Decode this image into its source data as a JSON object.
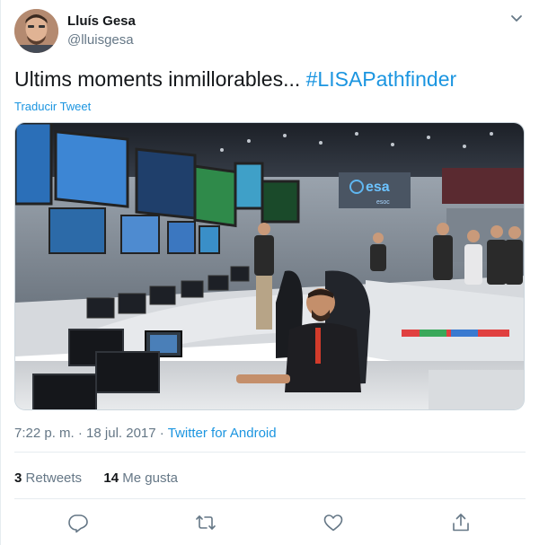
{
  "author": {
    "name": "Lluís Gesa",
    "handle": "@lluisgesa"
  },
  "tweet": {
    "text_before": "Ultims moments inmillorables... ",
    "hashtag": "#LISAPathfinder",
    "translate_label": "Traducir Tweet"
  },
  "media": {
    "screen_logo": "esa",
    "screen_subtitle": "esoc",
    "colors": {
      "room": "#8a94a0",
      "ceiling": "#2a2f38",
      "screen": "#3b78c8",
      "logo_bg": "#1e3a6e"
    }
  },
  "meta": {
    "time": "7:22 p. m.",
    "date": "18 jul. 2017",
    "separator": "·",
    "source": "Twitter for Android"
  },
  "stats": {
    "retweets_count": "3",
    "retweets_label": "Retweets",
    "likes_count": "14",
    "likes_label": "Me gusta"
  },
  "actions": [
    {
      "icon": "reply-icon"
    },
    {
      "icon": "retweet-icon"
    },
    {
      "icon": "like-icon"
    },
    {
      "icon": "share-icon"
    }
  ]
}
